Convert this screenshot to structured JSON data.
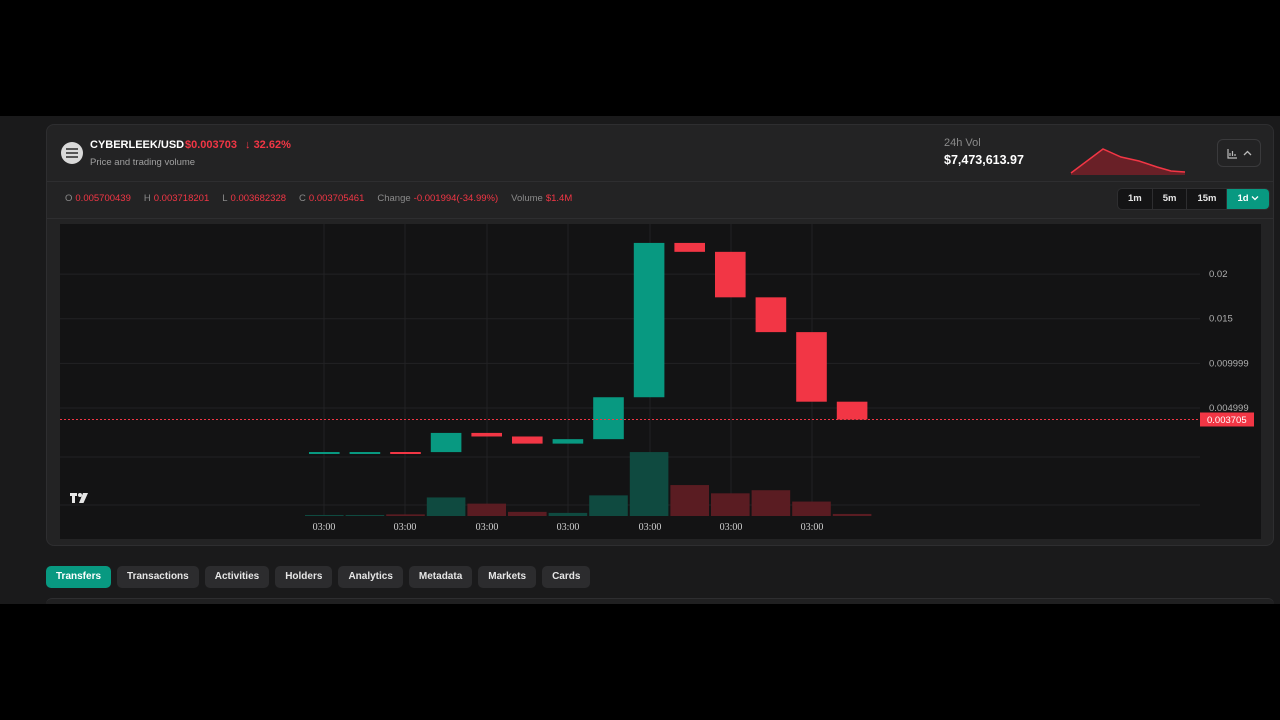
{
  "header": {
    "pair": "CYBERLEEK/USD",
    "price": "$0.003703",
    "change_arrow": "↓",
    "change_pct": "32.62%",
    "subtitle": "Price and trading volume",
    "vol_label": "24h Vol",
    "vol_value": "$7,473,613.97",
    "token_icon": "token-icon",
    "chart_toggle_icons": [
      "chart-icon",
      "chevron-up-icon"
    ]
  },
  "ohlc": {
    "o_label": "O",
    "o_value": "0.005700439",
    "h_label": "H",
    "h_value": "0.003718201",
    "l_label": "L",
    "l_value": "0.003682328",
    "c_label": "C",
    "c_value": "0.003705461",
    "change_label": "Change",
    "change_value": "-0.001994(-34.99%)",
    "volume_label": "Volume",
    "volume_value": "$1.4M"
  },
  "intervals": {
    "i1": "1m",
    "i2": "5m",
    "i3": "15m",
    "i4": "1d",
    "active": "1d"
  },
  "tabs": {
    "t1": "Transfers",
    "t2": "Transactions",
    "t3": "Activities",
    "t4": "Holders",
    "t5": "Analytics",
    "t6": "Metadata",
    "t7": "Markets",
    "t8": "Cards",
    "active": "Transfers"
  },
  "colors": {
    "up": "#089981",
    "down": "#f23645",
    "background": "#131314"
  },
  "chart_data": {
    "type": "candlestick",
    "price_axis_ticks": [
      "0.02",
      "0.015",
      "0.009999",
      "0.004999"
    ],
    "current_price_label": "0.003705",
    "time_labels": [
      "03:00",
      "03:00",
      "03:00",
      "03:00",
      "03:00",
      "03:00",
      "03:00"
    ],
    "candles": [
      {
        "open": 5e-05,
        "close": 6e-05,
        "dir": "up"
      },
      {
        "open": 5e-05,
        "close": 6e-05,
        "dir": "up"
      },
      {
        "open": 6e-05,
        "close": 5e-05,
        "dir": "down"
      },
      {
        "open": 5e-05,
        "close": 0.0022,
        "dir": "up"
      },
      {
        "open": 0.0022,
        "close": 0.0018,
        "dir": "down"
      },
      {
        "open": 0.0018,
        "close": 0.001,
        "dir": "down"
      },
      {
        "open": 0.001,
        "close": 0.0015,
        "dir": "up"
      },
      {
        "open": 0.0015,
        "close": 0.0062,
        "dir": "up"
      },
      {
        "open": 0.0062,
        "close": 0.0235,
        "dir": "up"
      },
      {
        "open": 0.0235,
        "close": 0.0225,
        "dir": "down"
      },
      {
        "open": 0.0225,
        "close": 0.0174,
        "dir": "down"
      },
      {
        "open": 0.0174,
        "close": 0.0135,
        "dir": "down"
      },
      {
        "open": 0.0135,
        "close": 0.0057,
        "dir": "down"
      },
      {
        "open": 0.0057,
        "close": 0.0037,
        "dir": "down"
      }
    ],
    "volumes": [
      0.5,
      0.5,
      0.8,
      9,
      6,
      2,
      1.5,
      10,
      31,
      15,
      11,
      12.5,
      7,
      1
    ]
  }
}
